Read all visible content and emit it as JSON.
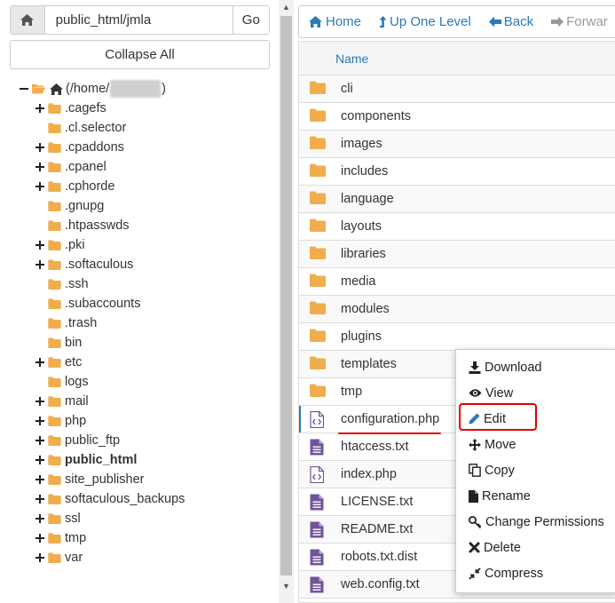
{
  "address_bar": {
    "path": "public_html/jmla",
    "go_label": "Go"
  },
  "collapse_all_label": "Collapse All",
  "tree": {
    "root_prefix": "(/home/",
    "root_suffix": ")",
    "items": [
      {
        "label": ".cagefs",
        "expandable": true,
        "bold": false
      },
      {
        "label": ".cl.selector",
        "expandable": false,
        "bold": false
      },
      {
        "label": ".cpaddons",
        "expandable": true,
        "bold": false
      },
      {
        "label": ".cpanel",
        "expandable": true,
        "bold": false
      },
      {
        "label": ".cphorde",
        "expandable": true,
        "bold": false
      },
      {
        "label": ".gnupg",
        "expandable": false,
        "bold": false
      },
      {
        "label": ".htpasswds",
        "expandable": false,
        "bold": false
      },
      {
        "label": ".pki",
        "expandable": true,
        "bold": false
      },
      {
        "label": ".softaculous",
        "expandable": true,
        "bold": false
      },
      {
        "label": ".ssh",
        "expandable": false,
        "bold": false
      },
      {
        "label": ".subaccounts",
        "expandable": false,
        "bold": false
      },
      {
        "label": ".trash",
        "expandable": false,
        "bold": false
      },
      {
        "label": "bin",
        "expandable": false,
        "bold": false
      },
      {
        "label": "etc",
        "expandable": true,
        "bold": false
      },
      {
        "label": "logs",
        "expandable": false,
        "bold": false
      },
      {
        "label": "mail",
        "expandable": true,
        "bold": false
      },
      {
        "label": "php",
        "expandable": true,
        "bold": false
      },
      {
        "label": "public_ftp",
        "expandable": true,
        "bold": false
      },
      {
        "label": "public_html",
        "expandable": true,
        "bold": true
      },
      {
        "label": "site_publisher",
        "expandable": true,
        "bold": false
      },
      {
        "label": "softaculous_backups",
        "expandable": true,
        "bold": false
      },
      {
        "label": "ssl",
        "expandable": true,
        "bold": false
      },
      {
        "label": "tmp",
        "expandable": true,
        "bold": false
      },
      {
        "label": "var",
        "expandable": true,
        "bold": false
      }
    ]
  },
  "toolbar": {
    "home": "Home",
    "up_one_level": "Up One Level",
    "back": "Back",
    "forward": "Forwar"
  },
  "file_table": {
    "header_name": "Name",
    "rows": [
      {
        "name": "cli",
        "type": "folder"
      },
      {
        "name": "components",
        "type": "folder"
      },
      {
        "name": "images",
        "type": "folder"
      },
      {
        "name": "includes",
        "type": "folder"
      },
      {
        "name": "language",
        "type": "folder"
      },
      {
        "name": "layouts",
        "type": "folder"
      },
      {
        "name": "libraries",
        "type": "folder"
      },
      {
        "name": "media",
        "type": "folder"
      },
      {
        "name": "modules",
        "type": "folder"
      },
      {
        "name": "plugins",
        "type": "folder"
      },
      {
        "name": "templates",
        "type": "folder"
      },
      {
        "name": "tmp",
        "type": "folder"
      },
      {
        "name": "configuration.php",
        "type": "code",
        "selected": true
      },
      {
        "name": "htaccess.txt",
        "type": "text"
      },
      {
        "name": "index.php",
        "type": "code"
      },
      {
        "name": "LICENSE.txt",
        "type": "text"
      },
      {
        "name": "README.txt",
        "type": "text"
      },
      {
        "name": "robots.txt.dist",
        "type": "text"
      },
      {
        "name": "web.config.txt",
        "type": "text"
      }
    ]
  },
  "context_menu": {
    "items": [
      {
        "label": "Download",
        "icon": "download-icon"
      },
      {
        "label": "View",
        "icon": "eye-icon"
      },
      {
        "label": "Edit",
        "icon": "pencil-icon"
      },
      {
        "label": "Move",
        "icon": "move-arrows-icon"
      },
      {
        "label": "Copy",
        "icon": "copy-icon"
      },
      {
        "label": "Rename",
        "icon": "file-icon"
      },
      {
        "label": "Change Permissions",
        "icon": "key-icon"
      },
      {
        "label": "Delete",
        "icon": "x-icon"
      },
      {
        "label": "Compress",
        "icon": "compress-icon"
      }
    ]
  },
  "colors": {
    "link_blue": "#2a7ab8",
    "folder_yellow": "#f0ad4e",
    "file_purple": "#6f5499",
    "highlight_red": "#e00000"
  }
}
